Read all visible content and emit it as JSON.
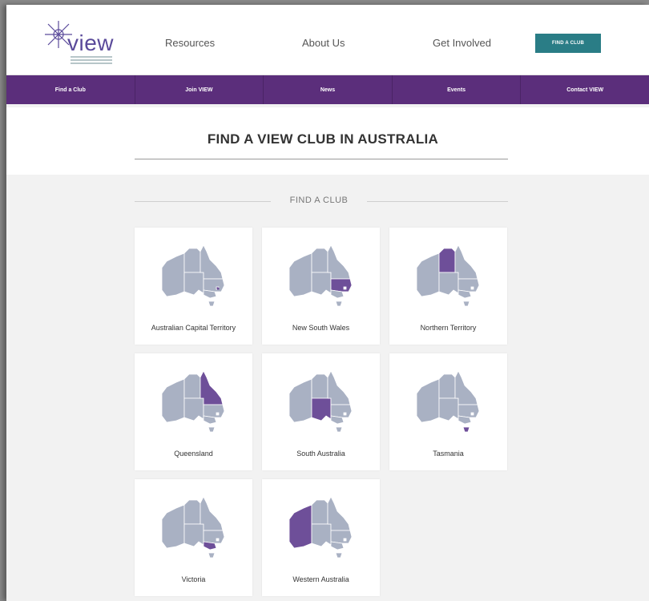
{
  "header": {
    "logo_text": "view",
    "nav": {
      "resources": "Resources",
      "about": "About Us",
      "involved": "Get Involved"
    },
    "find_button": "FIND A CLUB"
  },
  "subnav": {
    "items": [
      "Find a Club",
      "Join VIEW",
      "News",
      "Events",
      "Contact VIEW"
    ]
  },
  "hero": {
    "title": "FIND A VIEW CLUB IN AUSTRALIA"
  },
  "section": {
    "heading": "FIND A CLUB"
  },
  "colors": {
    "purple": "#5b2e7b",
    "teal": "#2a7d86",
    "map_base": "#a9b1c3",
    "map_highlight": "#6e4f99"
  },
  "states": [
    {
      "label": "Australian Capital Territory",
      "highlight": "act"
    },
    {
      "label": "New South Wales",
      "highlight": "nsw"
    },
    {
      "label": "Northern Territory",
      "highlight": "nt"
    },
    {
      "label": "Queensland",
      "highlight": "qld"
    },
    {
      "label": "South Australia",
      "highlight": "sa"
    },
    {
      "label": "Tasmania",
      "highlight": "tas"
    },
    {
      "label": "Victoria",
      "highlight": "vic"
    },
    {
      "label": "Western Australia",
      "highlight": "wa"
    }
  ]
}
